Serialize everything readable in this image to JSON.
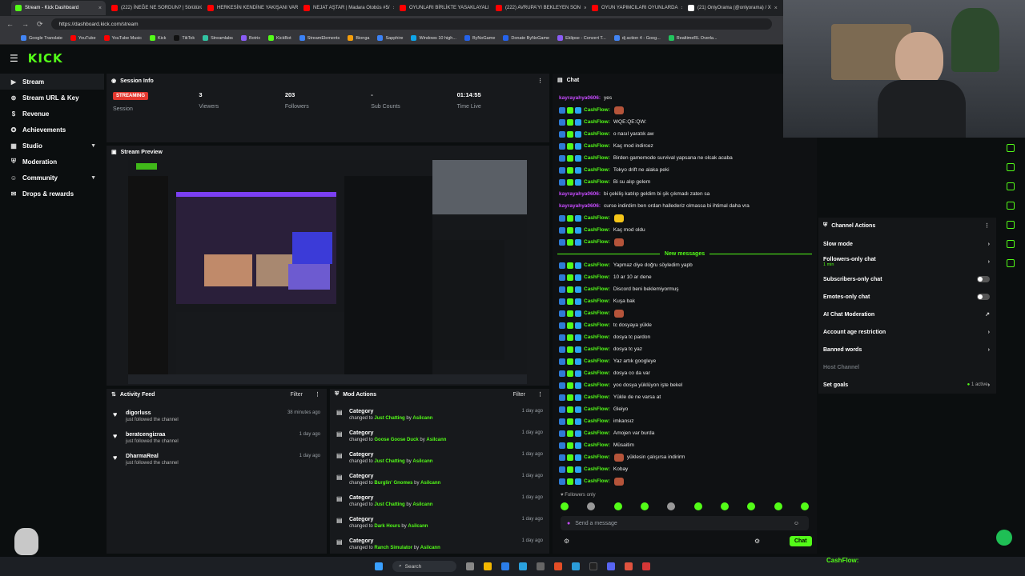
{
  "browser": {
    "tabs": [
      {
        "label": "Stream - Kick Dashboard",
        "color": "#53fc18",
        "active": true
      },
      {
        "label": "(222) İNEĞE NE SORDUN? | 5örütürü",
        "color": "#ff0000"
      },
      {
        "label": "HERKESİN KENDİNE YAKIŞANI VAR",
        "color": "#ff0000"
      },
      {
        "label": "NEJAT AŞTAR | Madara Otobüs #5/",
        "color": "#ff0000"
      },
      {
        "label": "OYUNLARI BİRLİKTE YASAKLAYALI",
        "color": "#ff0000"
      },
      {
        "label": "(222) AVRUPA'YI BEKLEYEN SON",
        "color": "#ff0000"
      },
      {
        "label": "OYUN YAPIMCILARI OYUNLARDA",
        "color": "#ff0000"
      },
      {
        "label": "(21) OnlyOrama (@onlyorama) / X",
        "color": "#ffffff"
      }
    ],
    "url": "https://dashboard.kick.com/stream",
    "bookmarks": [
      "Google Translate",
      "YouTube",
      "YouTube Music",
      "Kick",
      "TikTok",
      "Streamlabs",
      "Botrix",
      "KickBot",
      "StreamElements",
      "Bionga",
      "Sapphire",
      "Windows 10 high...",
      "ByNoGame",
      "Donate ByNoGame",
      "Eklipse - Convert T...",
      "dj action 4 - Goog...",
      "RealtimeRL Overla..."
    ]
  },
  "header": {
    "logo": "KICK"
  },
  "sidebar": {
    "items": [
      {
        "label": "Stream",
        "icon": "video-icon"
      },
      {
        "label": "Stream URL & Key",
        "icon": "globe-icon"
      },
      {
        "label": "Revenue",
        "icon": "dollar-icon"
      },
      {
        "label": "Achievements",
        "icon": "award-icon"
      },
      {
        "label": "Studio",
        "icon": "studio-icon",
        "chevron": true
      },
      {
        "label": "Moderation",
        "icon": "shield-icon"
      },
      {
        "label": "Community",
        "icon": "community-icon",
        "chevron": true
      },
      {
        "label": "Drops & rewards",
        "icon": "gift-icon"
      }
    ]
  },
  "session": {
    "title": "Session Info",
    "badge": "STREAMING",
    "session_label": "Session",
    "viewers": "3",
    "viewers_label": "Viewers",
    "followers": "203",
    "followers_label": "Followers",
    "subs": "-",
    "subs_label": "Sub Counts",
    "time": "01:14:55",
    "time_label": "Time Live"
  },
  "preview": {
    "title": "Stream Preview"
  },
  "activity": {
    "title": "Activity Feed",
    "filter": "Filter",
    "items": [
      {
        "name": "digorluss",
        "sub": "just followed the channel",
        "time": "38 minutes ago"
      },
      {
        "name": "beratcengizraa",
        "sub": "just followed the channel",
        "time": "1 day ago"
      },
      {
        "name": "DharmaReal",
        "sub": "just followed the channel",
        "time": "1 day ago"
      }
    ]
  },
  "mod": {
    "title": "Mod Actions",
    "filter": "Filter",
    "by": "by",
    "changed": "changed to",
    "items": [
      {
        "cat": "Category",
        "to": "Just Chatting",
        "user": "Asilcann",
        "time": "1 day ago"
      },
      {
        "cat": "Category",
        "to": "Goose Goose Duck",
        "user": "Asilcann",
        "time": "1 day ago"
      },
      {
        "cat": "Category",
        "to": "Just Chatting",
        "user": "Asilcann",
        "time": "1 day ago"
      },
      {
        "cat": "Category",
        "to": "Burglin' Gnomes",
        "user": "Asilcann",
        "time": "1 day ago"
      },
      {
        "cat": "Category",
        "to": "Just Chatting",
        "user": "Asilcann",
        "time": "1 day ago"
      },
      {
        "cat": "Category",
        "to": "Dark Hours",
        "user": "Asilcann",
        "time": "1 day ago"
      },
      {
        "cat": "Category",
        "to": "Ranch Simulator",
        "user": "Asilcann",
        "time": "1 day ago"
      }
    ]
  },
  "chat": {
    "title": "Chat",
    "new_messages": "New messages",
    "followers_only": "Followers only",
    "placeholder": "Send a message",
    "send": "Chat",
    "before": [
      {
        "user": "kayrayahya0606:",
        "msg": "yes",
        "alt": true
      },
      {
        "user": "CashFlow:",
        "msg": "",
        "emote": "red"
      },
      {
        "user": "CashFlow:",
        "msg": "WQE:QE:QW:"
      },
      {
        "user": "CashFlow:",
        "msg": "o nasıl yaratık aw"
      },
      {
        "user": "CashFlow:",
        "msg": "Kaç mod indircez"
      },
      {
        "user": "CashFlow:",
        "msg": "Birden gamemode survival yapsana ne olcak acaba"
      },
      {
        "user": "CashFlow:",
        "msg": "Tokyo drift ne alaka peki"
      },
      {
        "user": "CashFlow:",
        "msg": "Bi su alıp gelem"
      },
      {
        "user": "kayrayahya0606:",
        "msg": "bi çekiliş katılıp geldim bi şik çıkmadı zaten sa",
        "alt": true
      },
      {
        "user": "kayrayahya0606:",
        "msg": "curse indirdim ben ordan hallederiz olmassa bi ihtimal daha vra",
        "alt": true
      },
      {
        "user": "CashFlow:",
        "msg": "",
        "emote": "yellow"
      },
      {
        "user": "CashFlow:",
        "msg": "Kaç mod oldu"
      },
      {
        "user": "CashFlow:",
        "msg": "",
        "emote": "red"
      }
    ],
    "after": [
      {
        "user": "CashFlow:",
        "msg": "Yapmaz diye doğru söyledim yapb"
      },
      {
        "user": "CashFlow:",
        "msg": "10 ar 10 ar dene"
      },
      {
        "user": "CashFlow:",
        "msg": "Discord beni beklemiyormuş"
      },
      {
        "user": "CashFlow:",
        "msg": "Kuşa bak"
      },
      {
        "user": "CashFlow:",
        "msg": "",
        "emote": "red"
      },
      {
        "user": "CashFlow:",
        "msg": "tc dosyaya yükle"
      },
      {
        "user": "CashFlow:",
        "msg": "dosya tc pardon"
      },
      {
        "user": "CashFlow:",
        "msg": "dosya tc yaz"
      },
      {
        "user": "CashFlow:",
        "msg": "Yaz artık googleye"
      },
      {
        "user": "CashFlow:",
        "msg": "dosya co da var"
      },
      {
        "user": "CashFlow:",
        "msg": "yoo dosya yüklüyon işte bekel"
      },
      {
        "user": "CashFlow:",
        "msg": "Yükle de ne varsa at"
      },
      {
        "user": "CashFlow:",
        "msg": "Gleiyo"
      },
      {
        "user": "CashFlow:",
        "msg": "imkansız"
      },
      {
        "user": "CashFlow:",
        "msg": "Amojen var burda"
      },
      {
        "user": "CashFlow:",
        "msg": "Müsaitim"
      },
      {
        "user": "CashFlow:",
        "msg": "yüklesin çalışırsa indirirm",
        "emote": "red"
      },
      {
        "user": "CashFlow:",
        "msg": "Kobay"
      },
      {
        "user": "CashFlow:",
        "msg": "",
        "emote": "red"
      }
    ]
  },
  "channel_actions": {
    "title": "Channel Actions",
    "items": [
      {
        "label": "Slow mode",
        "right": "chevron"
      },
      {
        "label": "Followers-only chat",
        "sub": "1 min",
        "right": "chevron"
      },
      {
        "label": "Subscribers-only chat",
        "right": "toggle"
      },
      {
        "label": "Emotes-only chat",
        "right": "toggle"
      },
      {
        "label": "AI Chat Moderation",
        "right": "external"
      },
      {
        "label": "Account age restriction",
        "right": "chevron"
      },
      {
        "label": "Banned words",
        "right": "chevron"
      },
      {
        "label": "Host Channel",
        "right": "",
        "dim": true
      },
      {
        "label": "Set goals",
        "right": "active",
        "status": "1 active"
      }
    ]
  },
  "taskbar": {
    "search": "Search",
    "overlay_name": "CashFlow:"
  },
  "colors": {
    "brand": "#53fc18",
    "live": "#e3382f",
    "panel": "#17191c"
  }
}
